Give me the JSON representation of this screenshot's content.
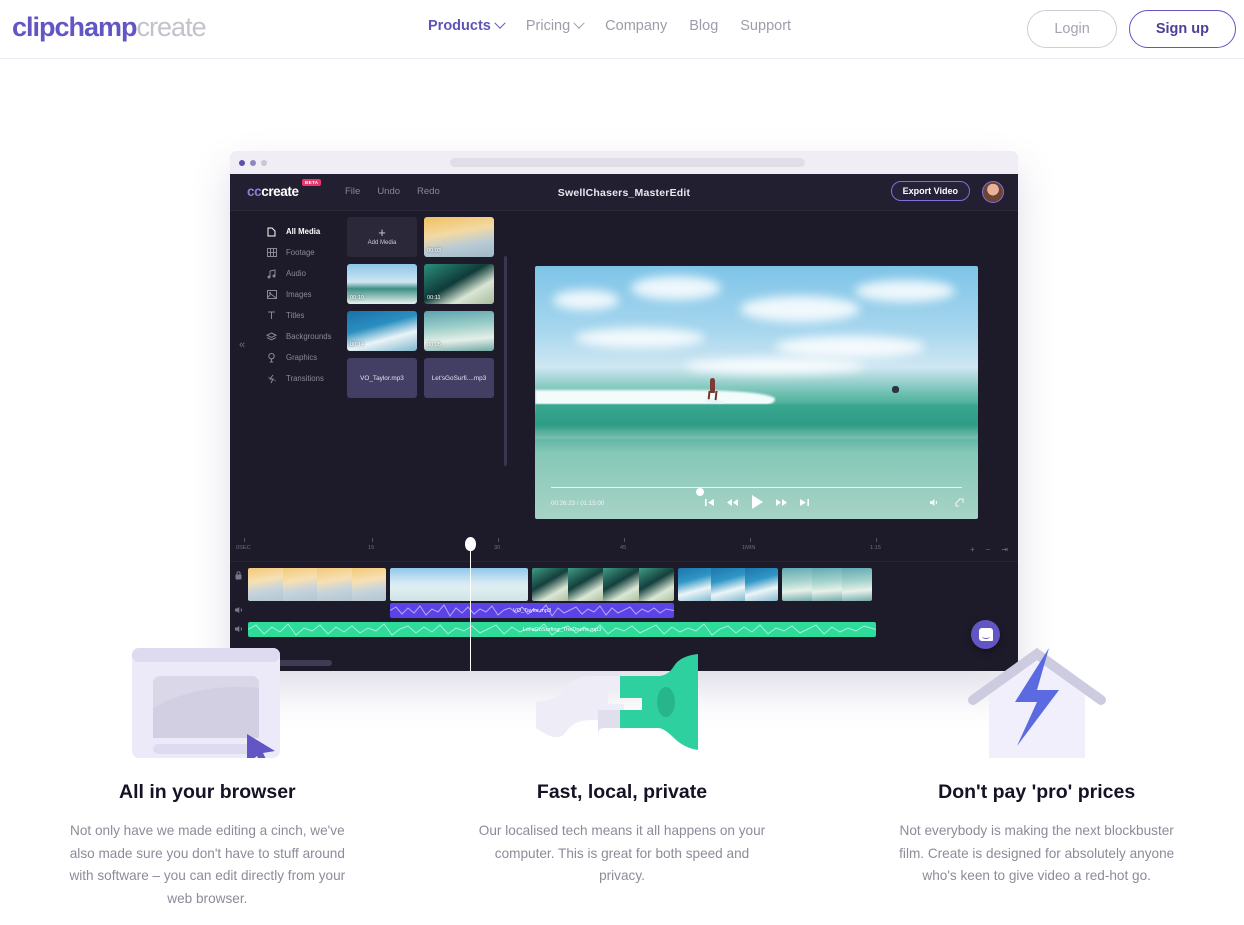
{
  "header": {
    "logo_primary": "clipchamp",
    "logo_secondary": "create",
    "nav": [
      {
        "label": "Products",
        "has_chevron": true,
        "active": true
      },
      {
        "label": "Pricing",
        "has_chevron": true,
        "active": false
      },
      {
        "label": "Company",
        "has_chevron": false,
        "active": false
      },
      {
        "label": "Blog",
        "has_chevron": false,
        "active": false
      },
      {
        "label": "Support",
        "has_chevron": false,
        "active": false
      }
    ],
    "login_label": "Login",
    "signup_label": "Sign up",
    "accent_color": "#6255c4",
    "muted_color": "#9e9cab"
  },
  "app_mockup": {
    "logo_prefix": "cc",
    "logo_suffix": "create",
    "beta_badge": "BETA",
    "menu": [
      "File",
      "Undo",
      "Redo"
    ],
    "project_title": "SwellChasers_MasterEdit",
    "export_label": "Export Video",
    "library_nav": [
      {
        "label": "All Media",
        "icon": "file-icon",
        "active": true
      },
      {
        "label": "Footage",
        "icon": "filmstrip-icon",
        "active": false
      },
      {
        "label": "Audio",
        "icon": "music-note-icon",
        "active": false
      },
      {
        "label": "Images",
        "icon": "image-icon",
        "active": false
      },
      {
        "label": "Titles",
        "icon": "text-icon",
        "active": false
      },
      {
        "label": "Backgrounds",
        "icon": "layers-icon",
        "active": false
      },
      {
        "label": "Graphics",
        "icon": "shapes-icon",
        "active": false
      },
      {
        "label": "Transitions",
        "icon": "transition-icon",
        "active": false
      }
    ],
    "add_media_label": "Add Media",
    "media_tiles": [
      {
        "type": "add",
        "label": "Add Media"
      },
      {
        "type": "video",
        "duration": "00:03",
        "thumb": "thm1"
      },
      {
        "type": "video",
        "duration": "00:19",
        "thumb": "thm2"
      },
      {
        "type": "video",
        "duration": "00:11",
        "thumb": "thm3"
      },
      {
        "type": "video",
        "duration": "00:14",
        "thumb": "thm4"
      },
      {
        "type": "video",
        "duration": "00:05",
        "thumb": "thm5"
      },
      {
        "type": "audio",
        "label": "VO_Taylor.mp3"
      },
      {
        "type": "audio",
        "label": "Let'sGoSurfi....mp3"
      }
    ],
    "player": {
      "current_time": "00:26:23",
      "total_time": "01:15:00",
      "timecode": "00:26:23 / 01:15:00",
      "controls": [
        "skip-start",
        "rewind",
        "play",
        "fast-forward",
        "skip-end"
      ],
      "volume_icon": "speaker-icon",
      "fullscreen_icon": "expand-icon"
    },
    "timeline": {
      "ruler_labels": [
        "0SEC",
        "15",
        "30",
        "45",
        "1MIN",
        "1:15"
      ],
      "zoom_controls": [
        "zoom-in",
        "zoom-out",
        "fit"
      ],
      "audio_clips": [
        {
          "label": "VO_Taylor.mp3",
          "color": "#5b43e8"
        },
        {
          "label": "Let'sGoSurfing_TheDrums.mp3",
          "color": "#2edb9b"
        }
      ],
      "lock_icon": "lock-icon",
      "speaker_icon": "speaker-icon"
    },
    "chat_widget_icon": "chat-bubble-icon"
  },
  "features": [
    {
      "icon": "browser-window-cursor-icon",
      "title": "All in your browser",
      "description": "Not only have we made editing a cinch, we've also made sure you don't have to stuff around with software – you can edit directly from your web browser."
    },
    {
      "icon": "plug-connect-icon",
      "title": "Fast, local, private",
      "description": "Our localised tech means it all happens on your computer. This is great for both speed and privacy."
    },
    {
      "icon": "house-lightning-icon",
      "title": "Don't pay 'pro' prices",
      "description": "Not everybody is making the next blockbuster film. Create is designed for absolutely anyone who's keen to give video a red-hot go."
    }
  ]
}
